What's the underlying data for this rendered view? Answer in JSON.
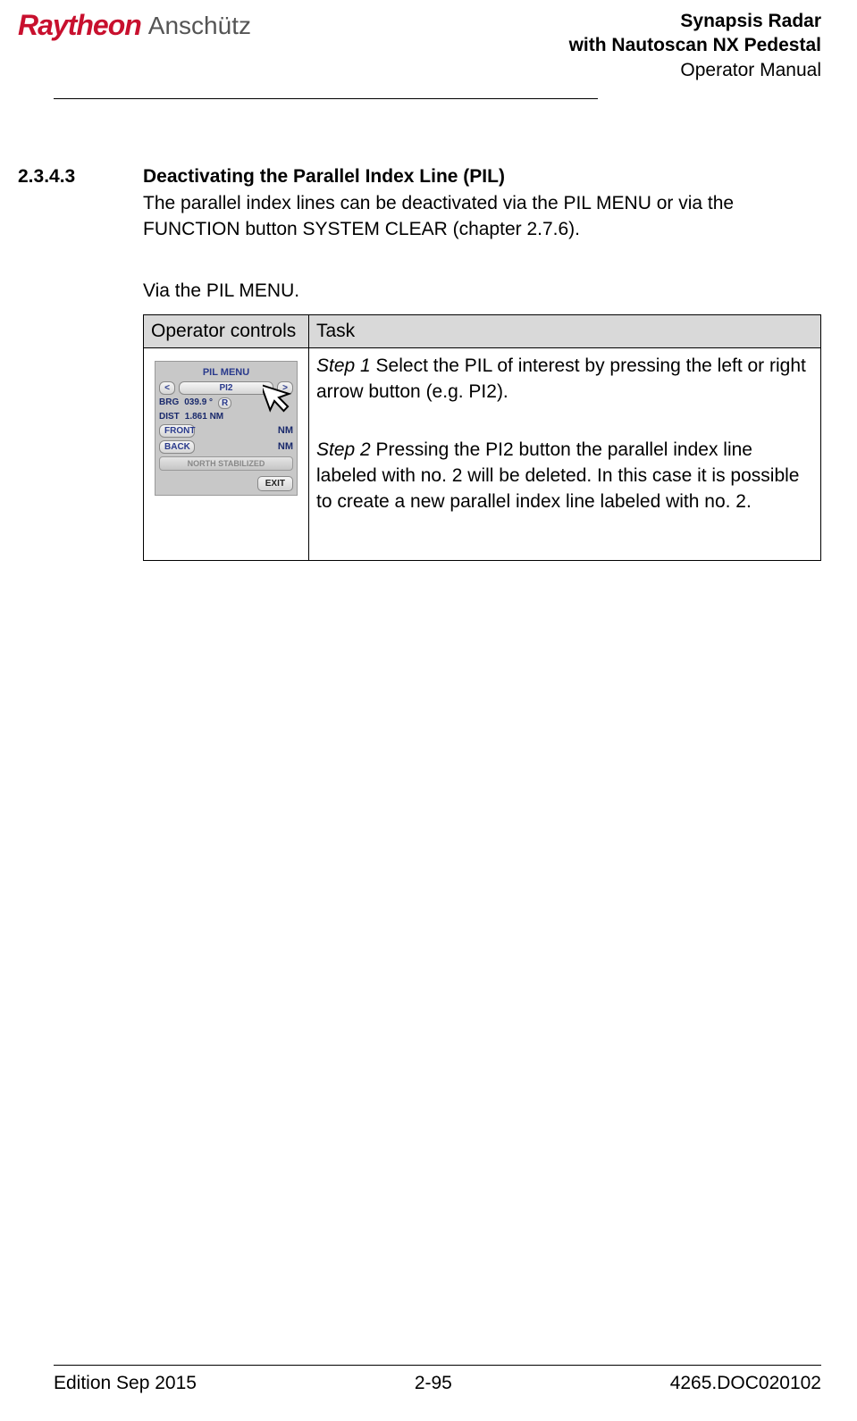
{
  "logo": {
    "raytheon": "Raytheon",
    "anschutz": "Anschütz"
  },
  "header": {
    "line1": "Synapsis Radar",
    "line2": "with Nautoscan NX Pedestal",
    "line3": "Operator Manual"
  },
  "section": {
    "number": "2.3.4.3",
    "title": "Deactivating the Parallel Index Line (PIL)",
    "intro": "The parallel index lines can be deactivated via the PIL MENU or via the FUNCTION button SYSTEM CLEAR (chapter 2.7.6).",
    "via": "Via the PIL MENU."
  },
  "table": {
    "header_col1": "Operator controls",
    "header_col2": "Task",
    "step1_label": "Step 1",
    "step1_text": " Select the PIL of interest by pressing the left or right arrow button (e.g. PI2).",
    "step2_label": "Step 2",
    "step2_text": " Pressing the PI2 button the parallel index line labeled with no. 2 will be deleted. In this case it is possible to create a new parallel index line labeled with no. 2."
  },
  "pil_menu": {
    "title": "PIL MENU",
    "left": "<",
    "selected": "PI2",
    "right": ">",
    "brg_label": "BRG",
    "brg_value": "039.9 °",
    "brg_r": "R",
    "dist_label": "DIST",
    "dist_value": "1.861 NM",
    "front_label": "FRONT",
    "front_unit": "NM",
    "back_label": "BACK",
    "back_unit": "NM",
    "stabilized": "NORTH STABILIZED",
    "exit": "EXIT"
  },
  "footer": {
    "edition": "Edition Sep 2015",
    "page": "2-95",
    "doc": "4265.DOC020102"
  }
}
